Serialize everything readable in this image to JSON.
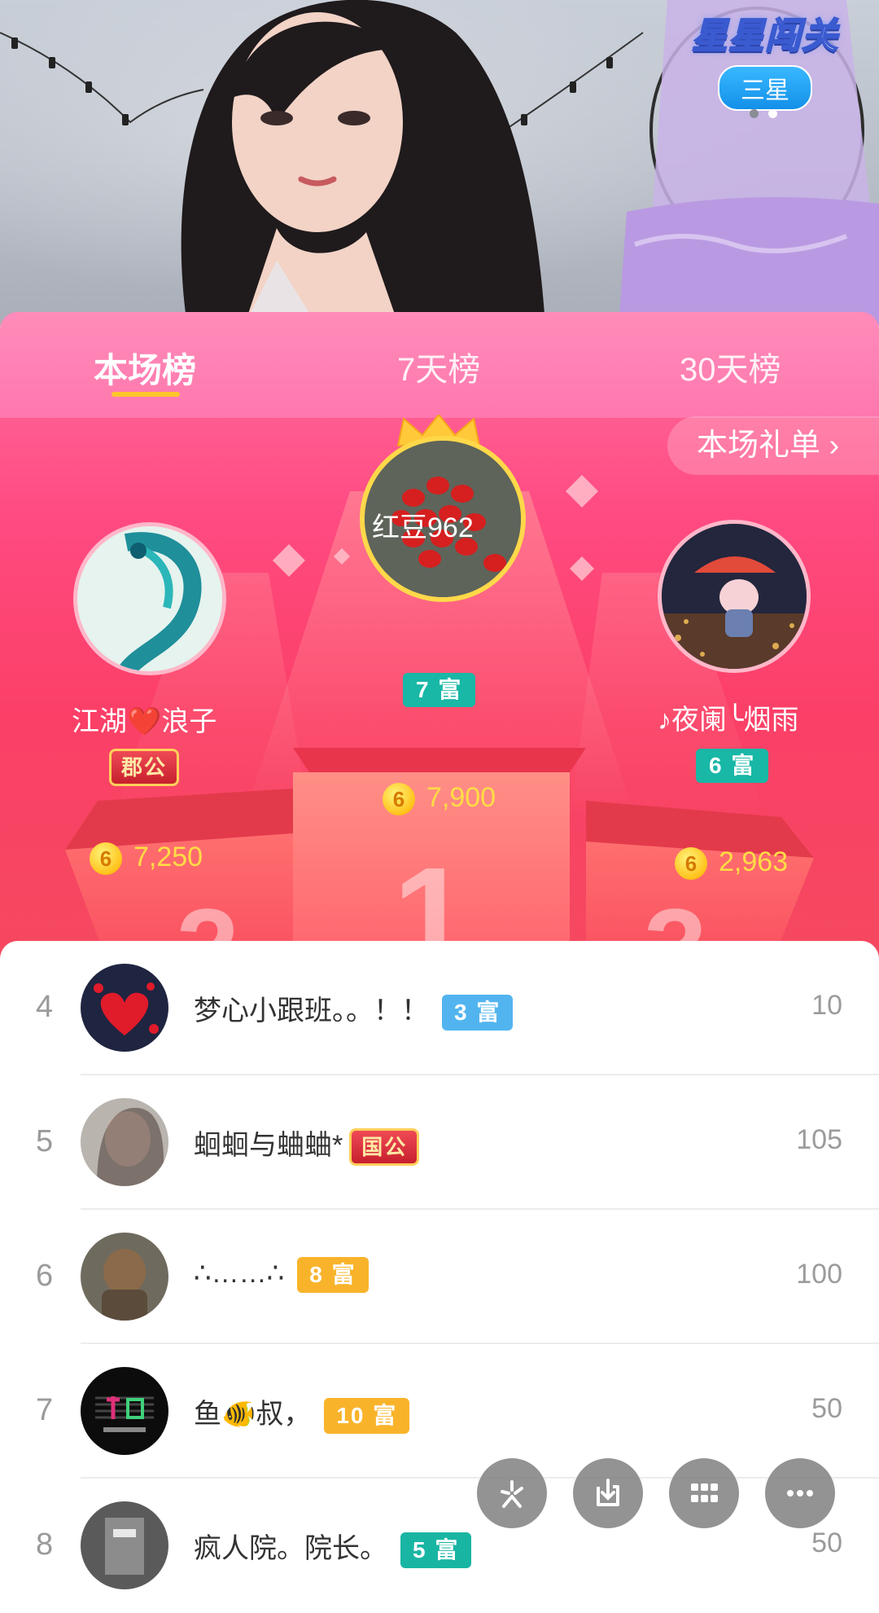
{
  "video": {
    "game_title": "星星闯关",
    "star_label": "三星",
    "page_dots": 2,
    "active_dot": 1
  },
  "tabs": [
    {
      "label": "本场榜",
      "active": true
    },
    {
      "label": "7天榜",
      "active": false
    },
    {
      "label": "30天榜",
      "active": false
    }
  ],
  "gift_list_link": "本场礼单 ›",
  "podium": {
    "first": {
      "name": "红豆962",
      "level": "7 富",
      "score": "7,900",
      "coin": "6"
    },
    "second": {
      "name": "江湖❤️浪子",
      "noble": "郡公",
      "score": "7,250",
      "coin": "6"
    },
    "third": {
      "name": "♪夜阑╰烟雨",
      "level": "6 富",
      "score": "2,963",
      "coin": "6"
    }
  },
  "list": [
    {
      "rank": "4",
      "name": "梦心小跟班。。！！",
      "badge": "3 富",
      "badge_color": "#52b4ef",
      "value": "10"
    },
    {
      "rank": "5",
      "name": "蛔蛔与蛐蛐*",
      "noble": "国公",
      "value": "105"
    },
    {
      "rank": "6",
      "name": "∴……∴",
      "badge": "8 富",
      "badge_color": "#f9b32b",
      "value": "100"
    },
    {
      "rank": "7",
      "name": "鱼🐠叔，",
      "badge": "10 富",
      "badge_color": "#f9b32b",
      "value": "50"
    },
    {
      "rank": "8",
      "name": "疯人院。院长。",
      "badge": "5 富",
      "badge_color": "#19b5a3",
      "value": "50"
    }
  ],
  "fabs": [
    "sparkle-icon",
    "download-icon",
    "grid-icon",
    "more-icon"
  ],
  "colors": {
    "panel_pink": "#fb3f67",
    "tab_underline": "#ffc52b",
    "score_yellow": "#ffdc45"
  }
}
